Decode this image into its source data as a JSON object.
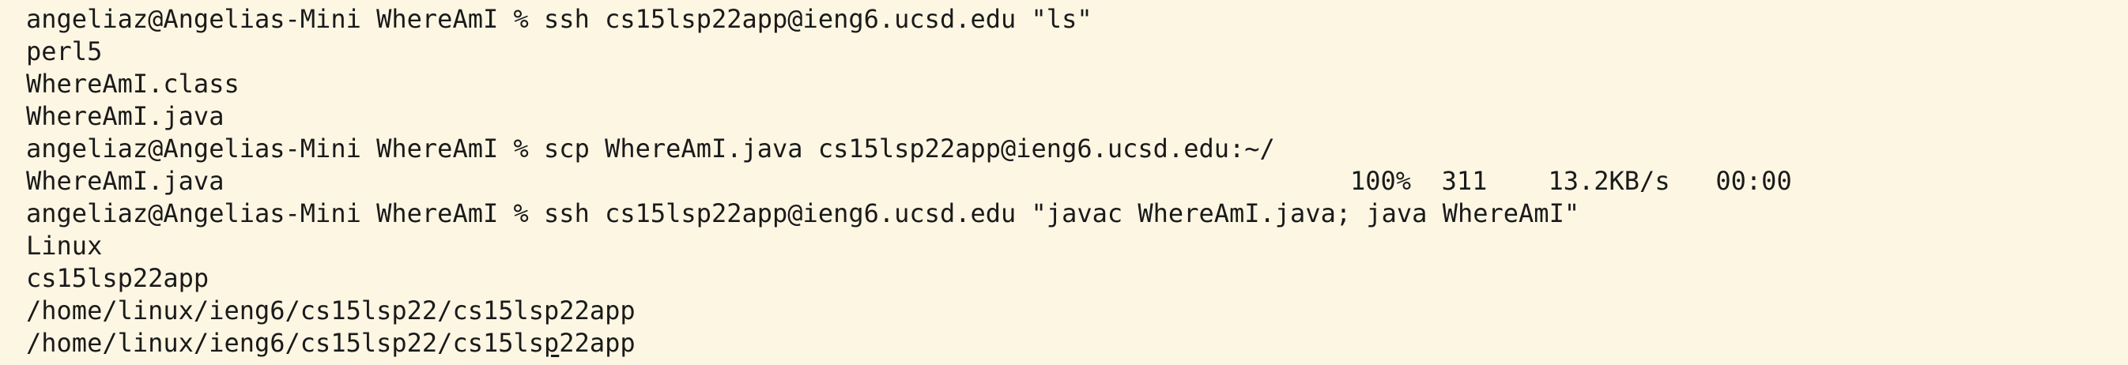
{
  "terminal": {
    "lines": [
      {
        "type": "prompt",
        "prompt": "angeliaz@Angelias-Mini WhereAmI % ",
        "command": "ssh cs15lsp22app@ieng6.ucsd.edu \"ls\""
      },
      {
        "type": "output",
        "text": "perl5"
      },
      {
        "type": "output",
        "text": "WhereAmI.class"
      },
      {
        "type": "output",
        "text": "WhereAmI.java"
      },
      {
        "type": "prompt",
        "prompt": "angeliaz@Angelias-Mini WhereAmI % ",
        "command": "scp WhereAmI.java cs15lsp22app@ieng6.ucsd.edu:~/"
      },
      {
        "type": "transfer",
        "file": "WhereAmI.java",
        "stats": "100%  311    13.2KB/s   00:00"
      },
      {
        "type": "prompt",
        "prompt": "angeliaz@Angelias-Mini WhereAmI % ",
        "command": "ssh cs15lsp22app@ieng6.ucsd.edu \"javac WhereAmI.java; java WhereAmI\""
      },
      {
        "type": "output",
        "text": "Linux"
      },
      {
        "type": "output",
        "text": "cs15lsp22app"
      },
      {
        "type": "output",
        "text": "/home/linux/ieng6/cs15lsp22/cs15lsp22app"
      },
      {
        "type": "cursor-output",
        "before": "/home/linux/ieng6/cs15lsp22/cs15ls",
        "cursor": "p",
        "after": "22app"
      }
    ]
  }
}
